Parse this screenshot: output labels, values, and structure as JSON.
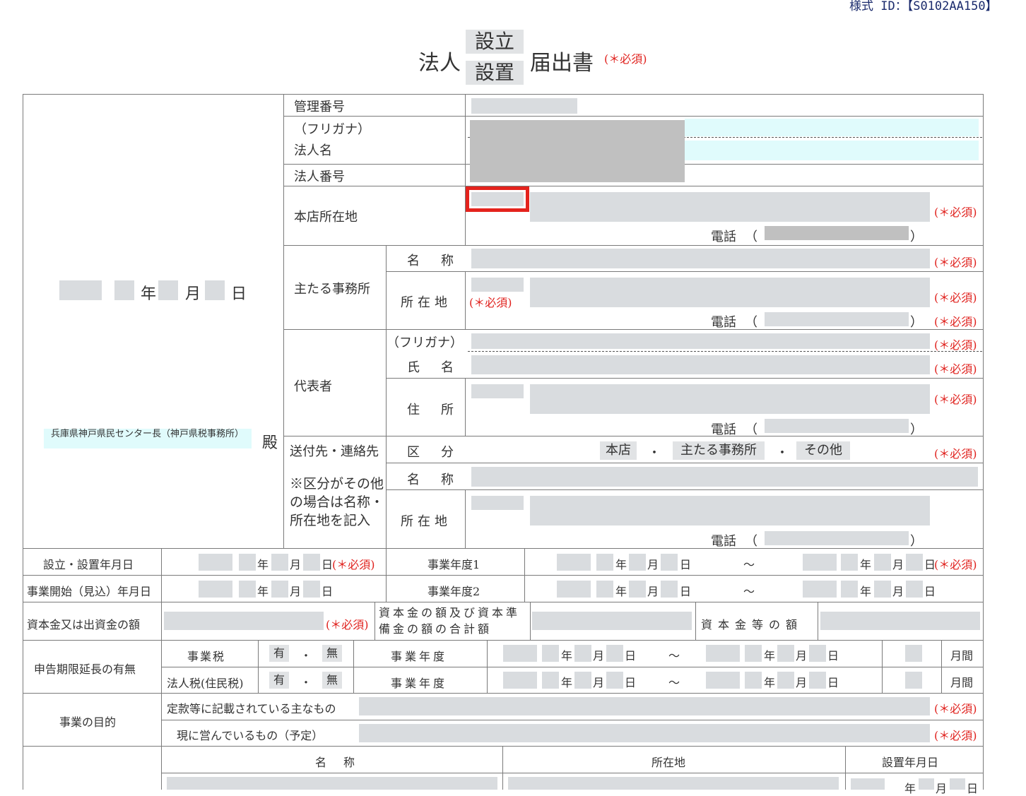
{
  "form_id": "様式 ID：【S0102AA150】",
  "title": {
    "prefix": "法人",
    "option1": "設立",
    "option2": "設置",
    "suffix": "届出書",
    "required": "(＊必須)"
  },
  "required_mark": "(＊必須)",
  "date_labels": {
    "year": "年",
    "month": "月",
    "day": "日"
  },
  "addressee": {
    "office": "兵庫県神戸県民センター長（神戸県税事務所）",
    "honorific": "殿"
  },
  "labels": {
    "management_number": "管理番号",
    "furigana": "（フリガナ）",
    "corporation_name": "法人名",
    "corporate_number": "法人番号",
    "head_office": "本店所在地",
    "phone": "電話",
    "paren_open": "（",
    "paren_close": "）",
    "main_office": "主たる事務所",
    "name": "名　称",
    "location": "所在地",
    "representative": "代表者",
    "furigana2": "（フリガナ）",
    "person_name": "氏　名",
    "address": "住　所",
    "send_to": "送付先・連絡先",
    "send_note": "※区分がその他の場合は名称・所在地を記入",
    "category": "区　分"
  },
  "category_options": [
    "本店",
    "主たる事務所",
    "その他"
  ],
  "separator": "・",
  "lower": {
    "establish_date": "設立・設置年月日",
    "business_start": "事業開始（見込）年月日",
    "fiscal_year1": "事業年度1",
    "fiscal_year2": "事業年度2",
    "tilde": "～",
    "capital": "資本金又は出資金の額",
    "capital_reserve": "資本金の額及び資本準備金の額の合計額",
    "capital_amount": "資本金等の額",
    "extension": "申告期限延長の有無",
    "business_tax": "事業税",
    "corporate_tax": "法人税(住民税)",
    "yes": "有",
    "no": "無",
    "fiscal_year": "事業年度",
    "months": "月間",
    "purpose": "事業の目的",
    "purpose_articles": "定款等に記載されている主なもの",
    "purpose_current": "現に営んでいるもの（予定）",
    "col_name": "名　称",
    "col_location": "所在地",
    "col_established": "設置年月日"
  }
}
